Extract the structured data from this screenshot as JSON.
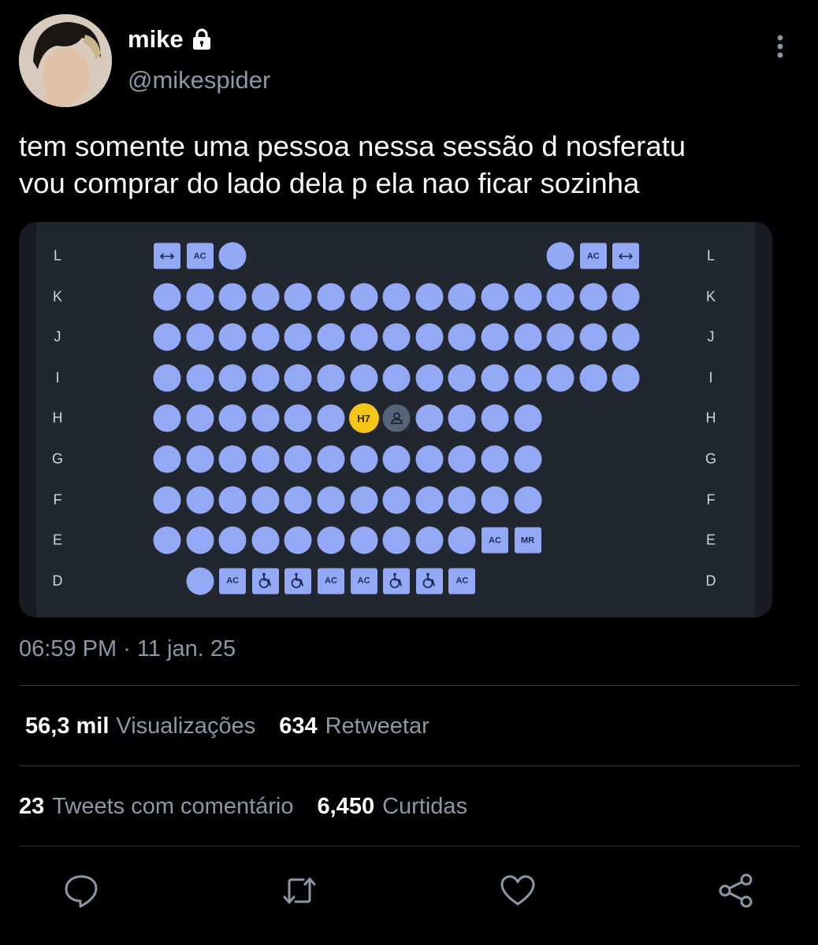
{
  "author": {
    "display_name": "mike",
    "handle": "@mikespider",
    "protected": true
  },
  "tweet": {
    "text_line1": "tem somente uma pessoa nessa sessão d nosferatu",
    "text_line2": "vou comprar do lado dela p ela nao ficar sozinha"
  },
  "seat_map": {
    "row_labels": [
      "L",
      "K",
      "J",
      "I",
      "H",
      "G",
      "F",
      "E",
      "D"
    ],
    "selected_seat": "H7",
    "accessible_tag": "AC",
    "mr_tag": "MR",
    "rows": {
      "L": [
        "double",
        "AC",
        "seat",
        "",
        "",
        "",
        "",
        "",
        "",
        "",
        "",
        "",
        "seat",
        "AC",
        "double"
      ],
      "K": [
        "seat",
        "seat",
        "seat",
        "seat",
        "seat",
        "seat",
        "seat",
        "seat",
        "seat",
        "seat",
        "seat",
        "seat",
        "seat",
        "seat",
        "seat"
      ],
      "J": [
        "seat",
        "seat",
        "seat",
        "seat",
        "seat",
        "seat",
        "seat",
        "seat",
        "seat",
        "seat",
        "seat",
        "seat",
        "seat",
        "seat",
        "seat"
      ],
      "I": [
        "seat",
        "seat",
        "seat",
        "seat",
        "seat",
        "seat",
        "seat",
        "seat",
        "seat",
        "seat",
        "seat",
        "seat",
        "seat",
        "seat",
        "seat"
      ],
      "H": [
        "seat",
        "seat",
        "seat",
        "seat",
        "seat",
        "seat",
        "H7",
        "occupied",
        "seat",
        "seat",
        "seat",
        "seat"
      ],
      "G": [
        "seat",
        "seat",
        "seat",
        "seat",
        "seat",
        "seat",
        "seat",
        "seat",
        "seat",
        "seat",
        "seat",
        "seat"
      ],
      "F": [
        "seat",
        "seat",
        "seat",
        "seat",
        "seat",
        "seat",
        "seat",
        "seat",
        "seat",
        "seat",
        "seat",
        "seat"
      ],
      "E": [
        "seat",
        "seat",
        "seat",
        "seat",
        "seat",
        "seat",
        "seat",
        "seat",
        "seat",
        "seat",
        "AC",
        "MR"
      ],
      "D": [
        "",
        "seat",
        "AC",
        "wheelchair",
        "wheelchair",
        "AC",
        "AC",
        "wheelchair",
        "wheelchair",
        "AC"
      ]
    },
    "colors": {
      "available": "#94a9f5",
      "selected": "#f5c518",
      "occupied": "#566478",
      "background": "#22262e"
    }
  },
  "timestamp": "06:59 PM · 11 jan. 25",
  "stats": {
    "views_count": "56,3 mil",
    "views_label": "Visualizações",
    "retweets_count": "634",
    "retweets_label": "Retweetar",
    "quotes_count": "23",
    "quotes_label": "Tweets com comentário",
    "likes_count": "6,450",
    "likes_label": "Curtidas"
  },
  "actions": [
    "reply-icon",
    "retweet-icon",
    "like-icon",
    "share-icon"
  ]
}
